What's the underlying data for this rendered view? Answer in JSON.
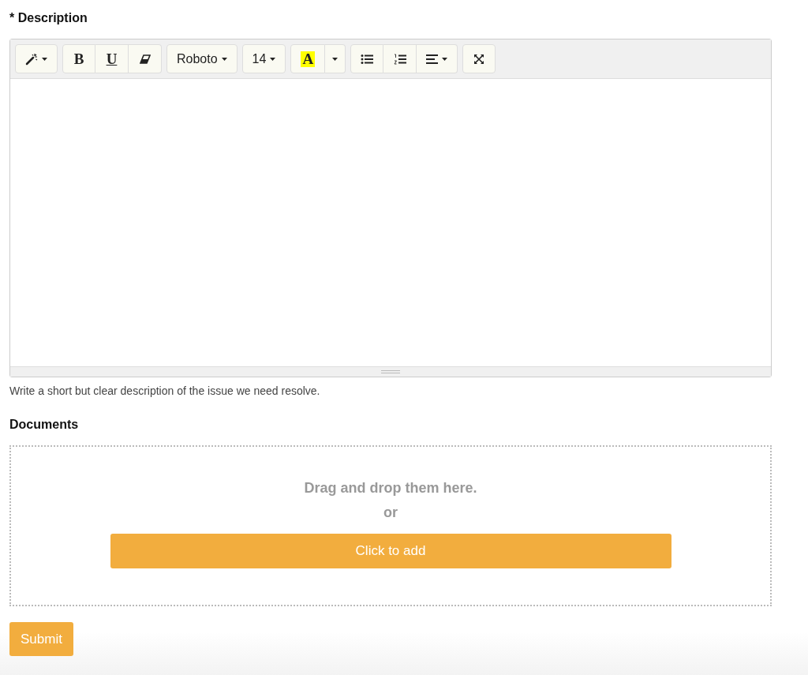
{
  "description": {
    "label": "* Description",
    "toolbar": [
      {
        "buttons": [
          {
            "kind": "magic",
            "caret": true
          }
        ]
      },
      {
        "buttons": [
          {
            "kind": "bold",
            "label": "B"
          },
          {
            "kind": "underline",
            "label": "U"
          },
          {
            "kind": "eraser"
          }
        ]
      },
      {
        "buttons": [
          {
            "kind": "text",
            "label": "Roboto",
            "caret": true
          }
        ]
      },
      {
        "buttons": [
          {
            "kind": "text",
            "label": "14",
            "caret": true
          }
        ]
      },
      {
        "buttons": [
          {
            "kind": "highlight",
            "label": "A",
            "color": "#ffff00"
          },
          {
            "kind": "caret",
            "caret": true
          }
        ]
      },
      {
        "buttons": [
          {
            "kind": "bullets"
          },
          {
            "kind": "numbered"
          },
          {
            "kind": "align",
            "caret": true
          }
        ]
      },
      {
        "buttons": [
          {
            "kind": "fullscreen"
          }
        ]
      }
    ],
    "help": "Write a short but clear description of the issue we need resolve."
  },
  "documents": {
    "label": "Documents",
    "drop_text": "Drag and drop them here.",
    "or": "or",
    "add_button": "Click to add"
  },
  "submit": "Submit"
}
